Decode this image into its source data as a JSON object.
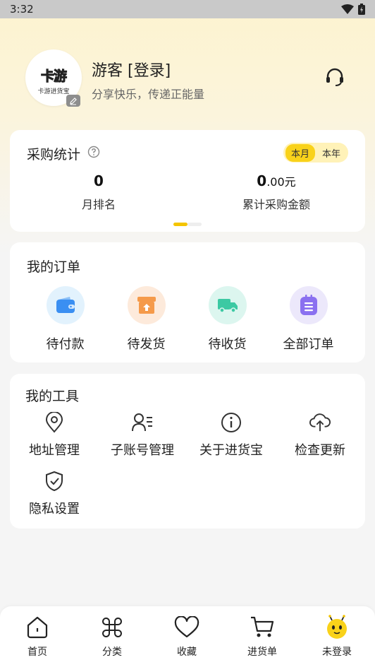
{
  "status_bar": {
    "time": "3:32"
  },
  "profile": {
    "logo_text": "卡游",
    "logo_sub": "卡游进货宝",
    "username": "游客 [登录]",
    "tagline": "分享快乐，传递正能量"
  },
  "stats": {
    "title": "采购统计",
    "period_options": [
      "本月",
      "本年"
    ],
    "selected_period": "本月",
    "rank_value": "0",
    "rank_label": "月排名",
    "total_int": "0",
    "total_dec": ".00",
    "total_unit": "元",
    "total_label": "累计采购金额"
  },
  "orders": {
    "title": "我的订单",
    "items": [
      {
        "label": "待付款",
        "icon": "wallet-icon",
        "bg": "#e2f2fd",
        "color": "#3a8ff2"
      },
      {
        "label": "待发货",
        "icon": "shipment-box-icon",
        "bg": "#fdeadb",
        "color": "#f59a4a"
      },
      {
        "label": "待收货",
        "icon": "truck-icon",
        "bg": "#dcf6ef",
        "color": "#3cc9a3"
      },
      {
        "label": "全部订单",
        "icon": "list-icon",
        "bg": "#ece8fb",
        "color": "#8a70f0"
      }
    ]
  },
  "tools": {
    "title": "我的工具",
    "items": [
      {
        "label": "地址管理",
        "icon": "location-pin-icon"
      },
      {
        "label": "子账号管理",
        "icon": "sub-account-icon"
      },
      {
        "label": "关于进货宝",
        "icon": "info-icon"
      },
      {
        "label": "检查更新",
        "icon": "cloud-upload-icon"
      },
      {
        "label": "隐私设置",
        "icon": "shield-check-icon"
      }
    ]
  },
  "tabbar": {
    "items": [
      {
        "label": "首页",
        "icon": "home-icon"
      },
      {
        "label": "分类",
        "icon": "category-icon"
      },
      {
        "label": "收藏",
        "icon": "heart-icon"
      },
      {
        "label": "进货单",
        "icon": "cart-icon"
      },
      {
        "label": "未登录",
        "icon": "mascot-avatar-icon"
      }
    ]
  },
  "colors": {
    "accent": "#f9d21a",
    "accent_light": "#fff2b8",
    "text_primary": "#222222",
    "text_secondary": "#666666"
  }
}
